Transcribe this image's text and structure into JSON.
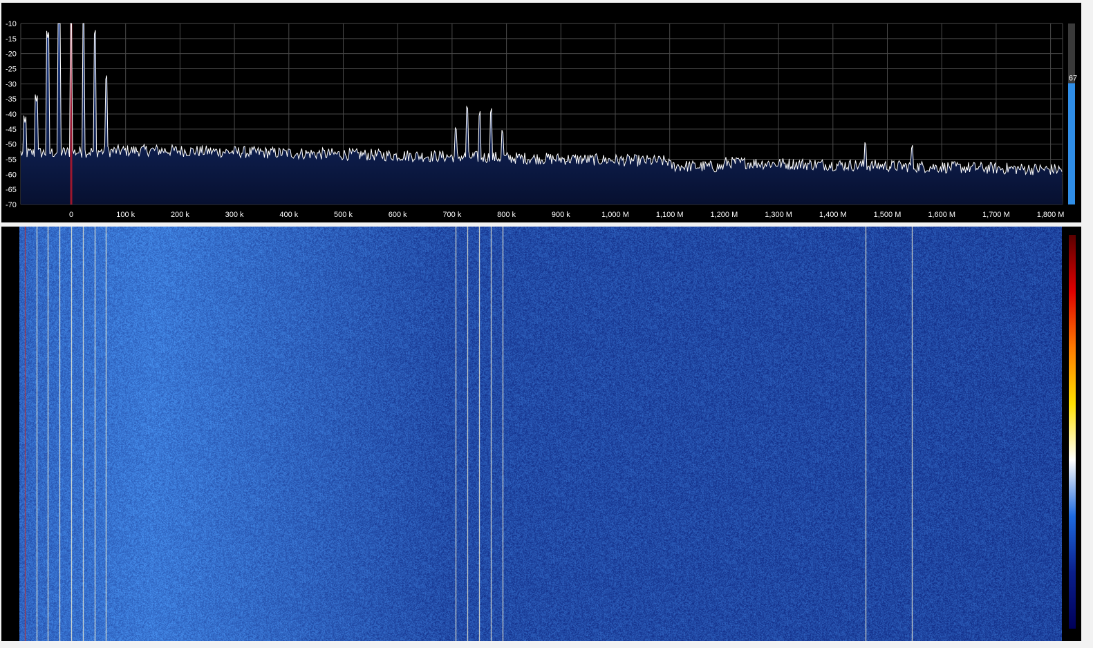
{
  "spectrum": {
    "y_ticks": [
      "-10",
      "-15",
      "-20",
      "-25",
      "-30",
      "-35",
      "-40",
      "-45",
      "-50",
      "-55",
      "-60",
      "-65",
      "-70"
    ],
    "x_ticks": [
      "0",
      "100 k",
      "200 k",
      "300 k",
      "400 k",
      "500 k",
      "600 k",
      "700 k",
      "800 k",
      "900 k",
      "1,000 M",
      "1,100 M",
      "1,200 M",
      "1,300 M",
      "1,400 M",
      "1,500 M",
      "1,600 M",
      "1,700 M",
      "1,800 M"
    ],
    "level_value": "67",
    "level_fraction": 0.67,
    "colors": {
      "background": "#000000",
      "grid": "#4a4a4a",
      "trace": "#ffffff",
      "fill_top": "#1c3c8a",
      "fill_bottom": "#071030",
      "tuning_marker": "#c0182a",
      "level_bar": "#2f8ee8",
      "level_bar_bg": "#3a3a3a"
    },
    "peaks": [
      {
        "freq": -85,
        "db": -43
      },
      {
        "freq": -64,
        "db": -36
      },
      {
        "freq": -43,
        "db": -15
      },
      {
        "freq": -22,
        "db": -10
      },
      {
        "freq": 0,
        "db": -10
      },
      {
        "freq": 22,
        "db": -10
      },
      {
        "freq": 43,
        "db": -14
      },
      {
        "freq": 64,
        "db": -29
      },
      {
        "freq": 707,
        "db": -46
      },
      {
        "freq": 728,
        "db": -39
      },
      {
        "freq": 750,
        "db": -41
      },
      {
        "freq": 771,
        "db": -40
      },
      {
        "freq": 793,
        "db": -47
      },
      {
        "freq": 1460,
        "db": -51
      },
      {
        "freq": 1545,
        "db": -52
      }
    ]
  },
  "waterfall": {
    "colorbar": [
      "#00005a",
      "#0a1f8c",
      "#1e6be0",
      "#ffffff",
      "#ffe000",
      "#ff7a00",
      "#e00000",
      "#5a0000"
    ]
  }
}
